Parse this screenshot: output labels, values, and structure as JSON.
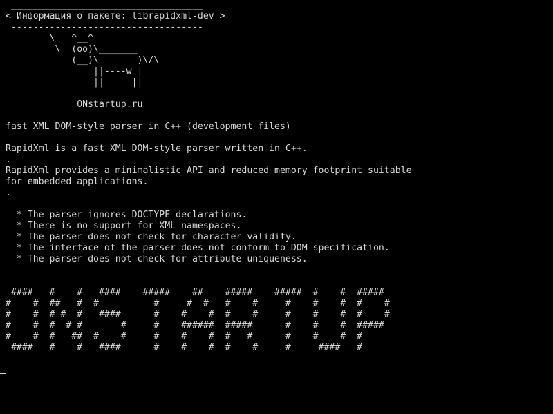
{
  "terminal": {
    "background": "#000000",
    "foreground": "#d8d8d8",
    "lines": [
      " ___________________________________",
      "< Информация о пакете: librapidxml-dev >",
      " -----------------------------------",
      "        \\   ^__^",
      "         \\  (oo)\\_______",
      "            (__)\\       )\\/\\",
      "                ||----w |",
      "                ||     ||",
      "",
      "             ONstartup.ru",
      "",
      "fast XML DOM-style parser in C++ (development files)",
      "",
      "RapidXml is a fast XML DOM-style parser written in C++.",
      ".",
      "RapidXml provides a minimalistic API and reduced memory footprint suitable",
      "for embedded applications.",
      ".",
      "",
      "  * The parser ignores DOCTYPE declarations.",
      "  * There is no support for XML namespaces.",
      "  * The parser does not check for character validity.",
      "  * The interface of the parser does not conform to DOM specification.",
      "  * The parser does not check for attribute uniqueness.",
      "",
      "",
      " ####   #    #   ####    #####    ##    #####    #####  #    #  #####",
      "#    #  ##   #  #          #     #  #   #    #     #    #    #  #    #",
      "#    #  # #  #   ####      #    #    #  #    #     #    #    #  #    #",
      "#    #  #  # #       #     #    ######  #####      #    #    #  #####",
      "#    #  #   ##  #    #     #    #    #  #   #      #    #    #  #",
      " ####   #    #   ####      #    #    #  #    #     #     ####   #",
      ""
    ],
    "cursor": "_"
  }
}
